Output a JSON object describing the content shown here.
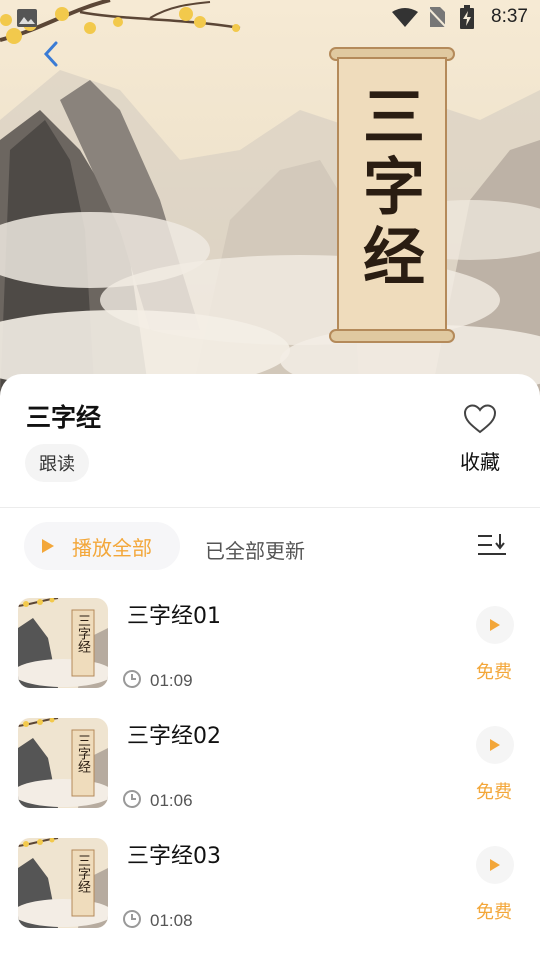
{
  "status": {
    "time": "8:37"
  },
  "hero": {
    "scroll_title": "三字经"
  },
  "album": {
    "title": "三字经",
    "tag": "跟读",
    "favorite_label": "收藏"
  },
  "controls": {
    "play_all_label": "播放全部",
    "update_status": "已全部更新"
  },
  "thumb_title": "三字经",
  "episodes": [
    {
      "title": "三字经01",
      "duration": "01:09",
      "badge": "免费"
    },
    {
      "title": "三字经02",
      "duration": "01:06",
      "badge": "免费"
    },
    {
      "title": "三字经03",
      "duration": "01:08",
      "badge": "免费"
    }
  ],
  "colors": {
    "accent": "#f3a73a",
    "back_arrow": "#3a7bd5"
  }
}
